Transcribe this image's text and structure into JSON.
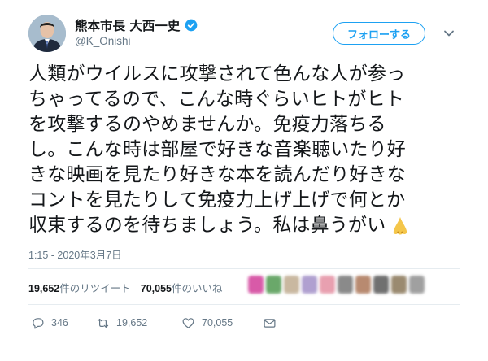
{
  "user": {
    "display_name": "熊本市長 大西一史",
    "handle": "@K_Onishi",
    "verified": true
  },
  "follow_button": {
    "label": "フォローする"
  },
  "tweet": {
    "lines": [
      "人類がウイルスに攻撃されて色んな人が参っ",
      "ちゃってるので、こんな時ぐらいヒトがヒト",
      "を攻撃するのやめませんか。免疫力落ちる",
      "し。こんな時は部屋で好きな音楽聴いたり好",
      "きな映画を見たり好きな本を読んだり好きな",
      "コントを見たりして免疫力上げ上げで何とか",
      "収束するのを待ちましょう。私は鼻うがい"
    ],
    "emoji": "nose-icon"
  },
  "timestamp": "1:15 - 2020年3月7日",
  "stats": {
    "retweets": {
      "count": "19,652",
      "label": "件のリツイート"
    },
    "likes": {
      "count": "70,055",
      "label": "件のいいね"
    }
  },
  "liker_colors": [
    "#d85aa8",
    "#6aa86a",
    "#c9b8a0",
    "#b0a0d0",
    "#e8a0b0",
    "#8a8a8a",
    "#b88a70",
    "#707070",
    "#9a8a70",
    "#a0a0a0"
  ],
  "actions": {
    "reply_count": "346",
    "retweet_count": "19,652",
    "like_count": "70,055"
  },
  "colors": {
    "accent": "#1da1f2",
    "text": "#14171a",
    "muted": "#657786"
  }
}
